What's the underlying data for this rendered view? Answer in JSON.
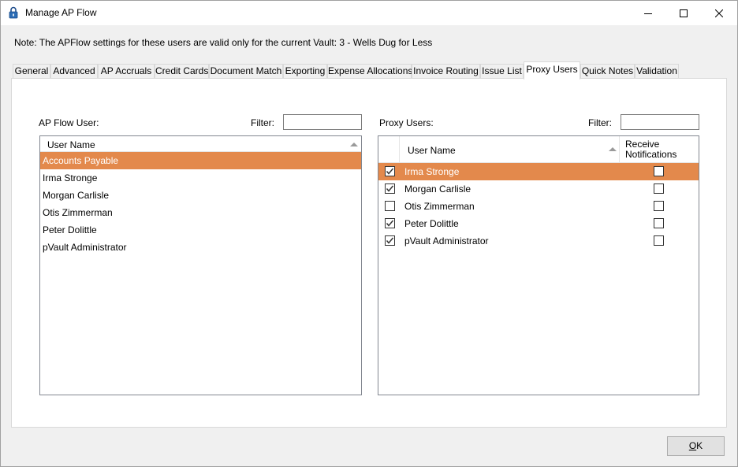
{
  "window": {
    "title": "Manage AP Flow",
    "controls": {
      "minimize": "minimize-icon",
      "maximize": "maximize-icon",
      "close": "close-icon"
    }
  },
  "note": "Note:  The APFlow settings for these users are valid only for the current Vault: 3 - Wells Dug for Less",
  "tabs": [
    {
      "label": "General"
    },
    {
      "label": "Advanced"
    },
    {
      "label": "AP Accruals"
    },
    {
      "label": "Credit Cards"
    },
    {
      "label": "Document Match"
    },
    {
      "label": "Exporting"
    },
    {
      "label": "Expense Allocations"
    },
    {
      "label": "Invoice Routing"
    },
    {
      "label": "Issue List"
    },
    {
      "label": "Proxy Users",
      "active": true
    },
    {
      "label": "Quick Notes"
    },
    {
      "label": "Validation"
    }
  ],
  "ap_flow_user": {
    "label": "AP Flow User:",
    "filter_label": "Filter:",
    "filter_value": "",
    "column_header": "User Name",
    "rows": [
      {
        "name": "Accounts Payable",
        "selected": true
      },
      {
        "name": "Irma Stronge"
      },
      {
        "name": "Morgan Carlisle"
      },
      {
        "name": "Otis Zimmerman"
      },
      {
        "name": "Peter Dolittle"
      },
      {
        "name": "pVault Administrator"
      }
    ]
  },
  "proxy_users": {
    "label": "Proxy Users:",
    "filter_label": "Filter:",
    "filter_value": "",
    "column_header": "User Name",
    "notifications_header_line1": "Receive",
    "notifications_header_line2": "Notifications",
    "rows": [
      {
        "name": "Irma Stronge",
        "checked": true,
        "notify": false,
        "selected": true
      },
      {
        "name": "Morgan Carlisle",
        "checked": true,
        "notify": false
      },
      {
        "name": "Otis Zimmerman",
        "checked": false,
        "notify": false
      },
      {
        "name": "Peter Dolittle",
        "checked": true,
        "notify": false
      },
      {
        "name": "pVault Administrator",
        "checked": true,
        "notify": false
      }
    ]
  },
  "ok_button": {
    "mnemonic": "O",
    "rest": "K"
  },
  "colors": {
    "selection": "#e3894c",
    "selection_text": "#ffffff"
  }
}
